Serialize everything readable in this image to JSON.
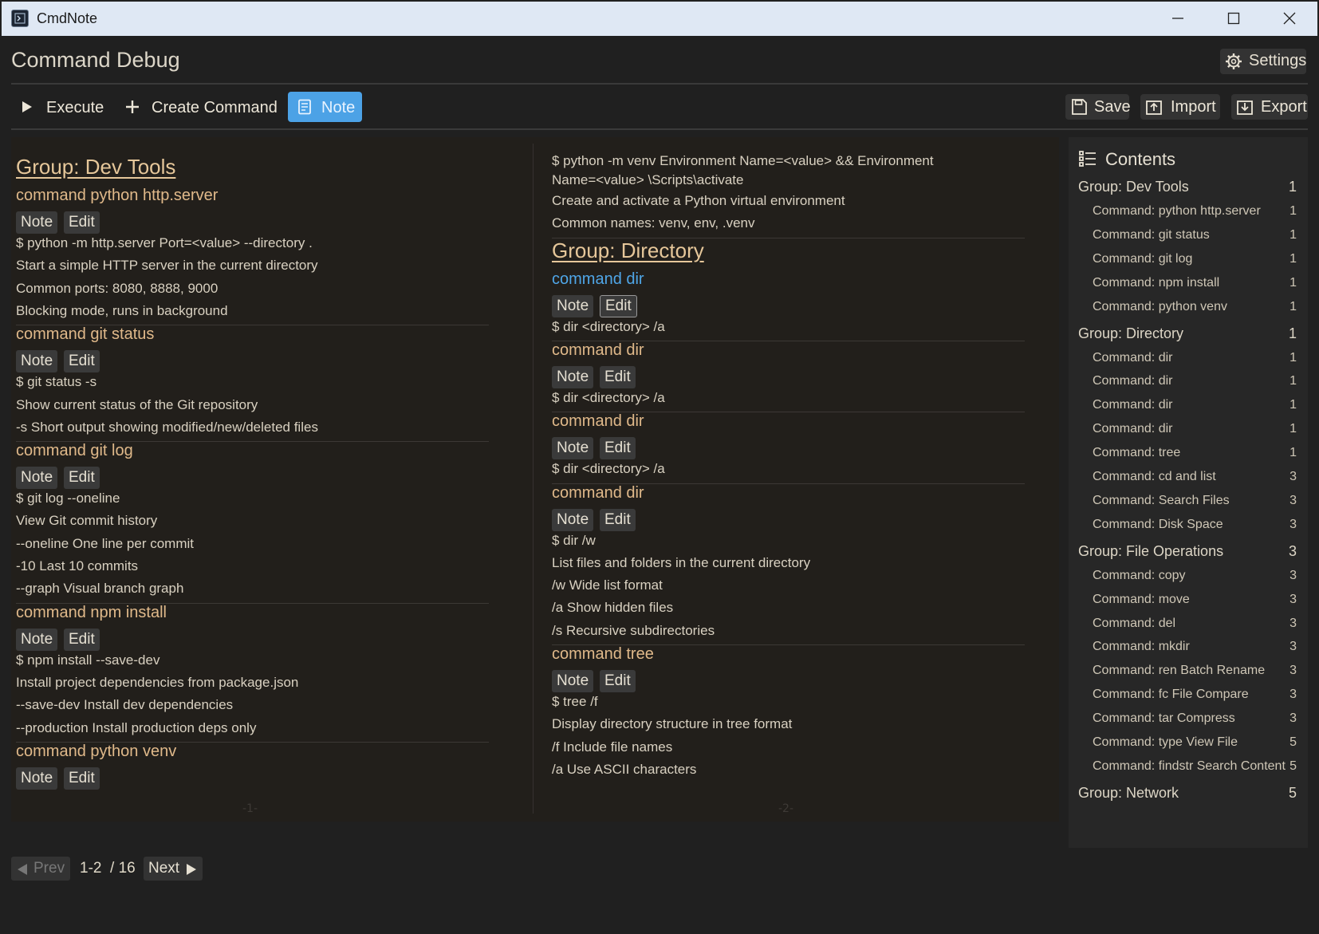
{
  "window": {
    "title": "CmdNote"
  },
  "header": {
    "title": "Command Debug",
    "settings_label": "Settings"
  },
  "toolbar": {
    "execute_label": "Execute",
    "create_label": "Create Command",
    "note_label": "Note",
    "save_label": "Save",
    "import_label": "Import",
    "export_label": "Export"
  },
  "columns": [
    {
      "page_label": "-1-",
      "items": [
        {
          "type": "group",
          "text": "Group: Dev Tools"
        },
        {
          "type": "cmd",
          "text": "command python http.server"
        },
        {
          "type": "buttons",
          "note": "Note",
          "edit": "Edit"
        },
        {
          "type": "line",
          "text": "$ python -m http.server  Port=<value> --directory ."
        },
        {
          "type": "line",
          "text": "Start a simple HTTP server in the current directory"
        },
        {
          "type": "line",
          "text": "Common ports: 8080, 8888, 9000"
        },
        {
          "type": "line",
          "text": "Blocking mode, runs in background"
        },
        {
          "type": "sep"
        },
        {
          "type": "cmd",
          "text": "command git status"
        },
        {
          "type": "buttons",
          "note": "Note",
          "edit": "Edit"
        },
        {
          "type": "line",
          "text": "$ git status -s"
        },
        {
          "type": "line",
          "text": "Show current status of the Git repository"
        },
        {
          "type": "line",
          "text": "-s Short output showing modified/new/deleted files"
        },
        {
          "type": "sep"
        },
        {
          "type": "cmd",
          "text": "command git log"
        },
        {
          "type": "buttons",
          "note": "Note",
          "edit": "Edit"
        },
        {
          "type": "line",
          "text": "$ git log --oneline"
        },
        {
          "type": "line",
          "text": "View Git commit history"
        },
        {
          "type": "line",
          "text": "--oneline One line per commit"
        },
        {
          "type": "line",
          "text": "-10 Last 10 commits"
        },
        {
          "type": "line",
          "text": "--graph Visual branch graph"
        },
        {
          "type": "sep"
        },
        {
          "type": "cmd",
          "text": "command npm install"
        },
        {
          "type": "buttons",
          "note": "Note",
          "edit": "Edit"
        },
        {
          "type": "line",
          "text": "$ npm install --save-dev"
        },
        {
          "type": "line",
          "text": "Install project dependencies from package.json"
        },
        {
          "type": "line",
          "text": "--save-dev Install dev dependencies"
        },
        {
          "type": "line",
          "text": "--production Install production deps only"
        },
        {
          "type": "sep"
        },
        {
          "type": "cmd",
          "text": "command python venv"
        },
        {
          "type": "buttons",
          "note": "Note",
          "edit": "Edit"
        }
      ]
    },
    {
      "page_label": "-2-",
      "items": [
        {
          "type": "wrapline",
          "text": "$ python -m venv  Environment Name=<value>  &&  Environment Name=<value> \\Scripts\\activate"
        },
        {
          "type": "line",
          "text": "Create and activate a Python virtual environment"
        },
        {
          "type": "line",
          "text": "Common names: venv, env, .venv"
        },
        {
          "type": "sep"
        },
        {
          "type": "group",
          "text": "Group: Directory"
        },
        {
          "type": "cmd",
          "text": "command dir",
          "active": true
        },
        {
          "type": "buttons",
          "note": "Note",
          "edit": "Edit",
          "edit_highlight": true
        },
        {
          "type": "line",
          "text": "$ dir <directory> /a"
        },
        {
          "type": "sep"
        },
        {
          "type": "cmd",
          "text": "command dir"
        },
        {
          "type": "buttons",
          "note": "Note",
          "edit": "Edit"
        },
        {
          "type": "line",
          "text": "$ dir <directory> /a"
        },
        {
          "type": "sep"
        },
        {
          "type": "cmd",
          "text": "command dir"
        },
        {
          "type": "buttons",
          "note": "Note",
          "edit": "Edit"
        },
        {
          "type": "line",
          "text": "$ dir <directory> /a"
        },
        {
          "type": "sep"
        },
        {
          "type": "cmd",
          "text": "command dir"
        },
        {
          "type": "buttons",
          "note": "Note",
          "edit": "Edit"
        },
        {
          "type": "line",
          "text": "$ dir /w"
        },
        {
          "type": "line",
          "text": "List files and folders in the current directory"
        },
        {
          "type": "line",
          "text": "/w Wide list format"
        },
        {
          "type": "line",
          "text": "/a Show hidden files"
        },
        {
          "type": "line",
          "text": "/s Recursive subdirectories"
        },
        {
          "type": "sep"
        },
        {
          "type": "cmd",
          "text": "command tree"
        },
        {
          "type": "buttons",
          "note": "Note",
          "edit": "Edit"
        },
        {
          "type": "line",
          "text": "$ tree /f"
        },
        {
          "type": "line",
          "text": "Display directory structure in tree format"
        },
        {
          "type": "line",
          "text": "/f Include file names"
        },
        {
          "type": "line",
          "text": "/a Use ASCII characters"
        }
      ]
    }
  ],
  "contents": {
    "title": "Contents",
    "items": [
      {
        "level": "group",
        "label": "Group: Dev Tools",
        "page": "1"
      },
      {
        "level": "cmd",
        "label": "Command: python http.server",
        "page": "1"
      },
      {
        "level": "cmd",
        "label": "Command: git status",
        "page": "1"
      },
      {
        "level": "cmd",
        "label": "Command: git log",
        "page": "1"
      },
      {
        "level": "cmd",
        "label": "Command: npm install",
        "page": "1"
      },
      {
        "level": "cmd",
        "label": "Command: python venv",
        "page": "1"
      },
      {
        "level": "group",
        "label": "Group: Directory",
        "page": "1"
      },
      {
        "level": "cmd",
        "label": "Command: dir",
        "page": "1"
      },
      {
        "level": "cmd",
        "label": "Command: dir",
        "page": "1"
      },
      {
        "level": "cmd",
        "label": "Command: dir",
        "page": "1"
      },
      {
        "level": "cmd",
        "label": "Command: dir",
        "page": "1"
      },
      {
        "level": "cmd",
        "label": "Command: tree",
        "page": "1"
      },
      {
        "level": "cmd",
        "label": "Command: cd and list",
        "page": "3"
      },
      {
        "level": "cmd",
        "label": "Command: Search Files",
        "page": "3"
      },
      {
        "level": "cmd",
        "label": "Command: Disk Space",
        "page": "3"
      },
      {
        "level": "group",
        "label": "Group: File Operations",
        "page": "3"
      },
      {
        "level": "cmd",
        "label": "Command: copy",
        "page": "3"
      },
      {
        "level": "cmd",
        "label": "Command: move",
        "page": "3"
      },
      {
        "level": "cmd",
        "label": "Command: del",
        "page": "3"
      },
      {
        "level": "cmd",
        "label": "Command: mkdir",
        "page": "3"
      },
      {
        "level": "cmd",
        "label": "Command: ren Batch Rename",
        "page": "3"
      },
      {
        "level": "cmd",
        "label": "Command: fc File Compare",
        "page": "3"
      },
      {
        "level": "cmd",
        "label": "Command: tar Compress",
        "page": "3"
      },
      {
        "level": "cmd",
        "label": "Command: type View File",
        "page": "5"
      },
      {
        "level": "cmd",
        "label": "Command: findstr Search Content",
        "page": "5"
      },
      {
        "level": "group",
        "label": "Group: Network",
        "page": "5"
      }
    ]
  },
  "pager": {
    "prev_label": "Prev",
    "next_label": "Next",
    "range": "1-2",
    "total": "/ 16"
  },
  "colors": {
    "accent": "#4ca2e6",
    "heading": "#e6c79a",
    "command": "#e0b98a",
    "active_command": "#4fa6e8"
  }
}
